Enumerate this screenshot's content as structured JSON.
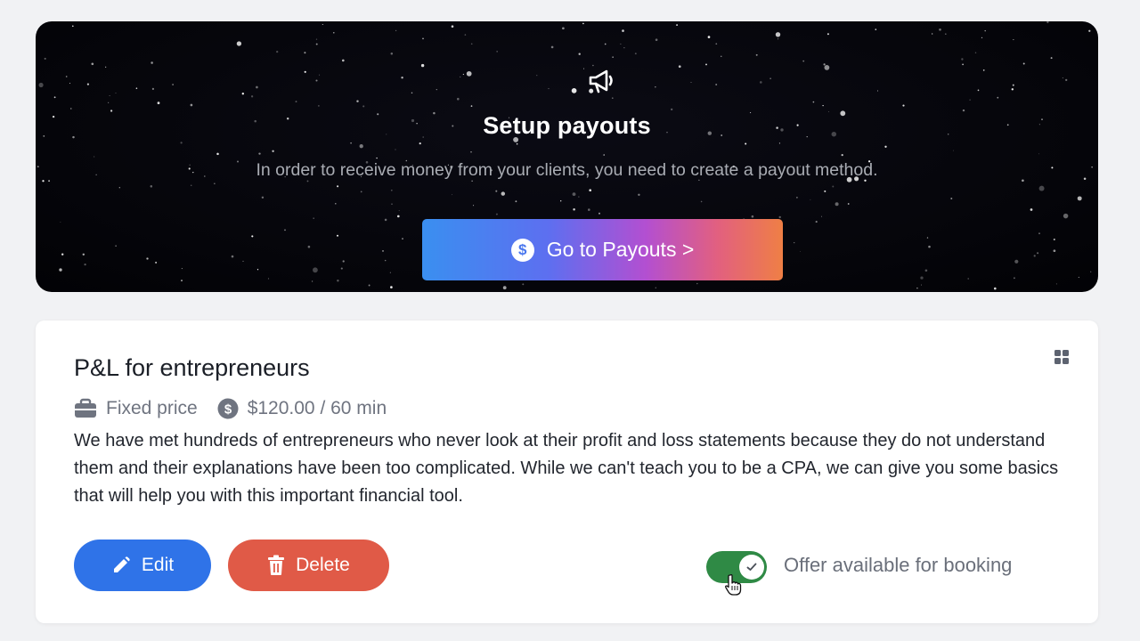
{
  "banner": {
    "icon": "megaphone-icon",
    "title": "Setup payouts",
    "subtitle": "In order to receive money from your clients, you need to create a payout method.",
    "button_label": "Go to Payouts >",
    "button_icon": "dollar-circle-icon",
    "button_glyph": "$"
  },
  "offer": {
    "title": "P&L for entrepreneurs",
    "pricing_type": "Fixed price",
    "price": "$120.00 / 60 min",
    "description": "We have met hundreds of entrepreneurs who never look at their profit and loss statements because they do not understand them and their explanations have been too complicated. While we can't teach you to be a CPA, we can give you some basics that will help you with this important financial tool.",
    "edit_label": "Edit",
    "delete_label": "Delete",
    "toggle_label": "Offer available for booking",
    "toggle_on": true
  },
  "colors": {
    "edit": "#2f73e8",
    "delete": "#e05a47",
    "toggle": "#2f8a45"
  }
}
